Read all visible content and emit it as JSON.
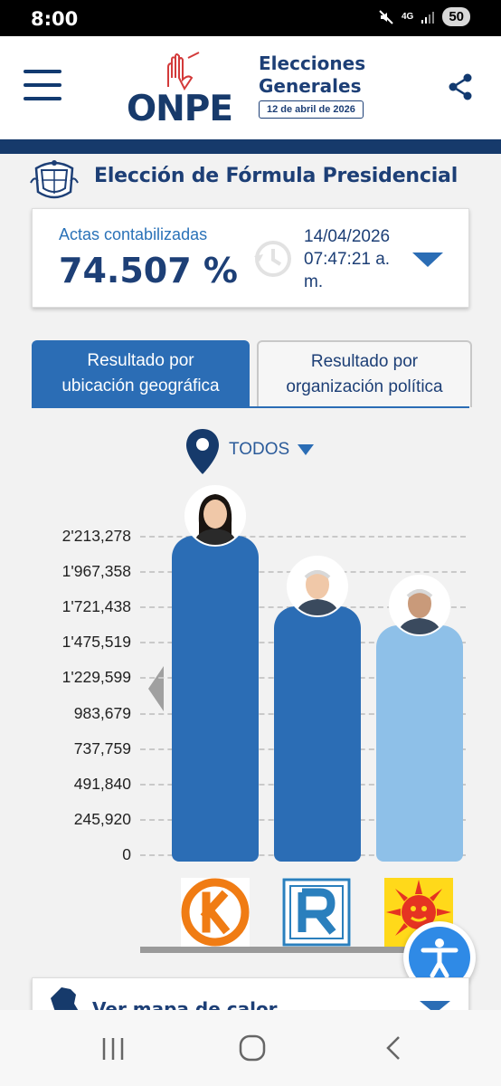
{
  "status_bar": {
    "time": "8:00",
    "network": "4G",
    "battery": "50"
  },
  "header": {
    "logo_text": "ONPE",
    "title_line1": "Elecciones",
    "title_line2": "Generales",
    "election_date": "12 de abril de 2026"
  },
  "page": {
    "title": "Elección de Fórmula Presidencial"
  },
  "actas": {
    "label": "Actas contabilizadas",
    "value": "74.507 %",
    "date": "14/04/2026",
    "time": "07:47:21 a. m."
  },
  "tabs": [
    {
      "label_line1": "Resultado por",
      "label_line2": "ubicación geográfica",
      "active": true
    },
    {
      "label_line1": "Resultado por",
      "label_line2": "organización política",
      "active": false
    }
  ],
  "location": {
    "label": "TODOS"
  },
  "chart_data": {
    "type": "bar",
    "y_ticks": [
      "2'213,278",
      "1'967,358",
      "1'721,438",
      "1'475,519",
      "1'229,599",
      "983,679",
      "737,759",
      "491,840",
      "245,920",
      "0"
    ],
    "ylim": [
      0,
      2213278
    ],
    "values": [
      2213278,
      1721438,
      1590000
    ],
    "colors": [
      "#2b6db5",
      "#2b6db5",
      "#8ec0e8"
    ]
  },
  "parties": [
    {
      "icon": "fuerza-popular-k-logo"
    },
    {
      "icon": "renovacion-popular-r-logo"
    },
    {
      "icon": "sun-logo"
    }
  ],
  "heat_map": {
    "label": "Ver mapa de calor"
  }
}
